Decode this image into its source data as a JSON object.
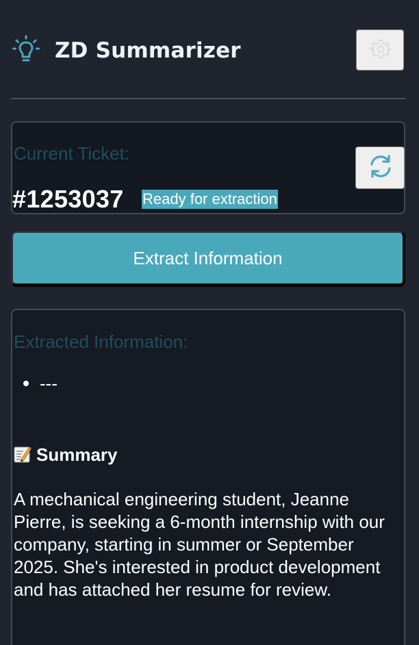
{
  "header": {
    "title": "ZD Summarizer",
    "icon": "lightbulb-icon",
    "settings_icon": "gear-icon"
  },
  "ticket": {
    "label": "Current Ticket:",
    "number": "#1253037",
    "status": "Ready for extraction",
    "refresh_icon": "refresh-icon"
  },
  "actions": {
    "extract_label": "Extract Information"
  },
  "extracted": {
    "label": "Extracted Information:",
    "bullets": [
      "---"
    ],
    "summary_heading": "Summary",
    "summary_icon": "memo-icon",
    "summary_text": "A mechanical engineering student, Jeanne Pierre, is seeking a 6-month internship with our company, starting in summer or September 2025. She's interested in product development and has attached her resume for review."
  },
  "colors": {
    "background": "#20242e",
    "accent": "#4aa8bb",
    "muted_label": "#1f4f5c",
    "card_border": "#444a55"
  }
}
